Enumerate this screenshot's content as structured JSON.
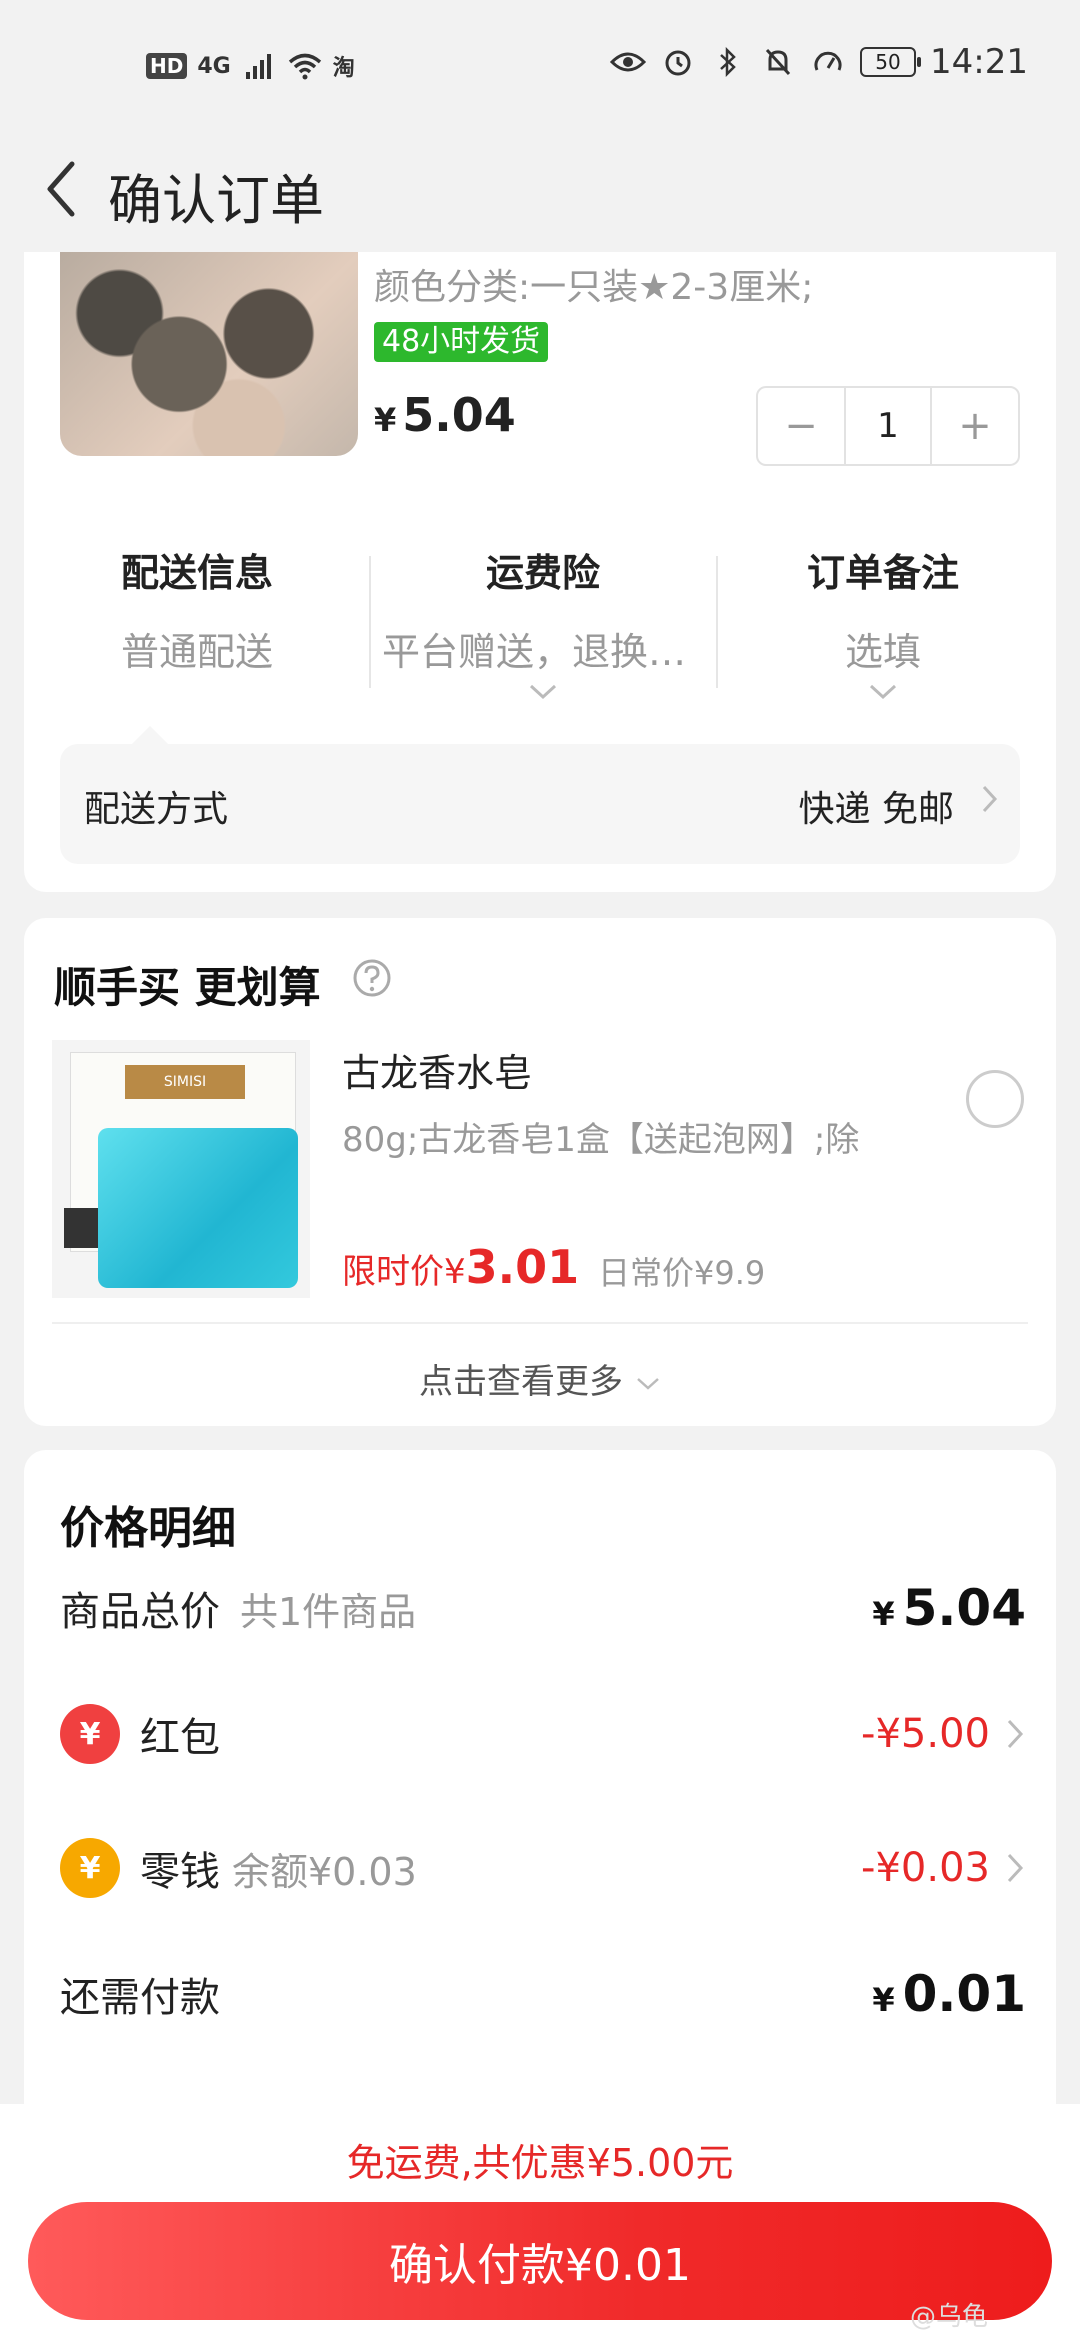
{
  "status_bar": {
    "hd": "HD",
    "network": "4G",
    "carrier_icon": "淘",
    "battery": "50",
    "time": "14:21"
  },
  "nav": {
    "title": "确认订单"
  },
  "product": {
    "spec": "颜色分类:一只装★2-3厘米;",
    "tag": "48小时发货",
    "yen": "¥",
    "price": "5.04",
    "quantity": "1",
    "minus": "−",
    "plus": "+"
  },
  "options": [
    {
      "label": "配送信息",
      "value": "普通配送"
    },
    {
      "label": "运费险",
      "value": "平台赠送，退换货可..."
    },
    {
      "label": "订单备注",
      "value": "选填"
    }
  ],
  "delivery": {
    "label": "配送方式",
    "value": "快递 免邮"
  },
  "addon": {
    "title": "顺手买 更划算",
    "brand": "SIMISI",
    "name": "古龙香水皂",
    "desc": "80g;古龙香皂1盒【送起泡网】;除",
    "limit_label": "限时价¥",
    "limit_price": "3.01",
    "daily_price": "日常价¥9.9",
    "view_more": "点击查看更多"
  },
  "price_detail": {
    "title": "价格明细",
    "total_label": "商品总价",
    "total_sub": "共1件商品",
    "total_yen": "¥",
    "total_value": "5.04",
    "redpacket_label": "红包",
    "redpacket_icon": "¥",
    "redpacket_value": "-¥5.00",
    "change_label": "零钱",
    "change_icon": "¥",
    "change_sub": "余额¥0.03",
    "change_value": "-¥0.03",
    "due_label": "还需付款",
    "due_yen": "¥",
    "due_value": "0.01"
  },
  "bottom": {
    "saving": "免运费,共优惠¥5.00元",
    "pay_button": "确认付款¥0.01",
    "watermark": "@乌龟"
  },
  "colors": {
    "accent_red": "#e62828",
    "tag_green": "#2db82d",
    "background": "#f2f2f2"
  }
}
